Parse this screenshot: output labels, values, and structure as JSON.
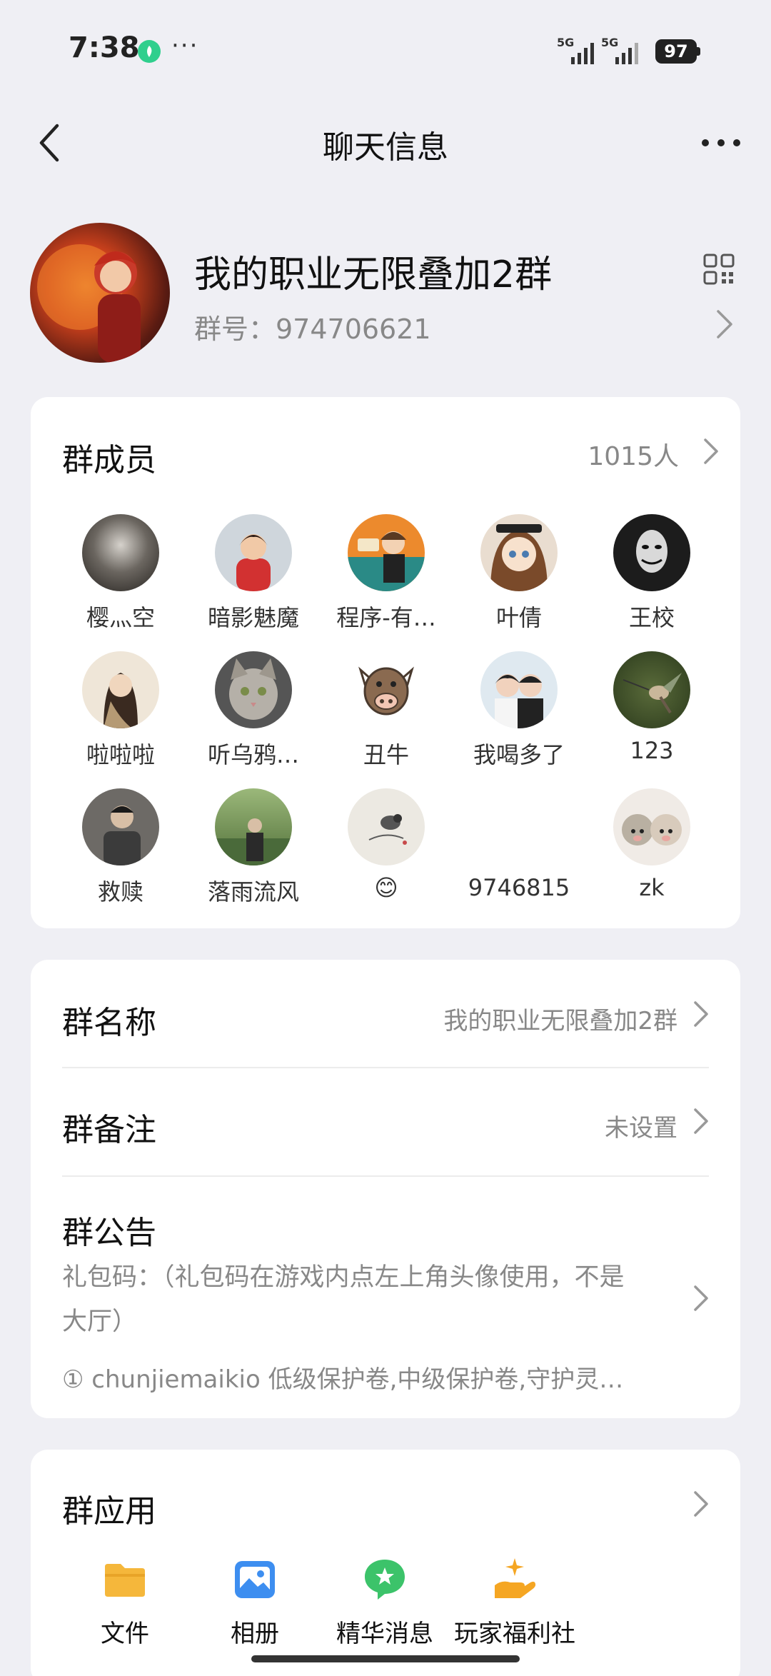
{
  "status_bar": {
    "time": "7:38",
    "more": "···",
    "signal1_label": "5G",
    "signal2_label": "5G",
    "battery": "97"
  },
  "nav": {
    "title": "聊天信息",
    "back_icon": "chevron-left-icon",
    "more_icon": "more-dots-icon"
  },
  "group": {
    "name": "我的职业无限叠加2群",
    "id_text": "群号：974706621",
    "qr_icon": "qr-code-icon"
  },
  "members": {
    "title": "群成员",
    "count": "1015人",
    "list": [
      {
        "name": "樱灬空"
      },
      {
        "name": "暗影魅魔"
      },
      {
        "name": "程序-有…"
      },
      {
        "name": "叶倩"
      },
      {
        "name": "王校"
      },
      {
        "name": "啦啦啦"
      },
      {
        "name": "听乌鸦…"
      },
      {
        "name": "丑牛"
      },
      {
        "name": "我喝多了"
      },
      {
        "name": "123"
      },
      {
        "name": "救赎"
      },
      {
        "name": "落雨流风"
      },
      {
        "name": "😊"
      },
      {
        "name": "9746815"
      },
      {
        "name": "zk"
      }
    ]
  },
  "settings": {
    "group_name_label": "群名称",
    "group_name_value": "我的职业无限叠加2群",
    "group_remark_label": "群备注",
    "group_remark_value": "未设置",
    "notice_label": "群公告",
    "notice_line1": "礼包码：（礼包码在游戏内点左上角头像使用，不是",
    "notice_line2": "大厅）",
    "notice_line3": "① chunjiemaikio 低级保护卷,中级保护卷,守护灵…"
  },
  "apps": {
    "title": "群应用",
    "items": [
      {
        "label": "文件",
        "icon": "folder-icon",
        "color": "#f5b73b"
      },
      {
        "label": "相册",
        "icon": "photo-album-icon",
        "color": "#3d8ef0"
      },
      {
        "label": "精华消息",
        "icon": "star-message-icon",
        "color": "#3cc36a"
      },
      {
        "label": "玩家福利社",
        "icon": "gift-hand-icon",
        "color": "#f5a623"
      }
    ]
  }
}
